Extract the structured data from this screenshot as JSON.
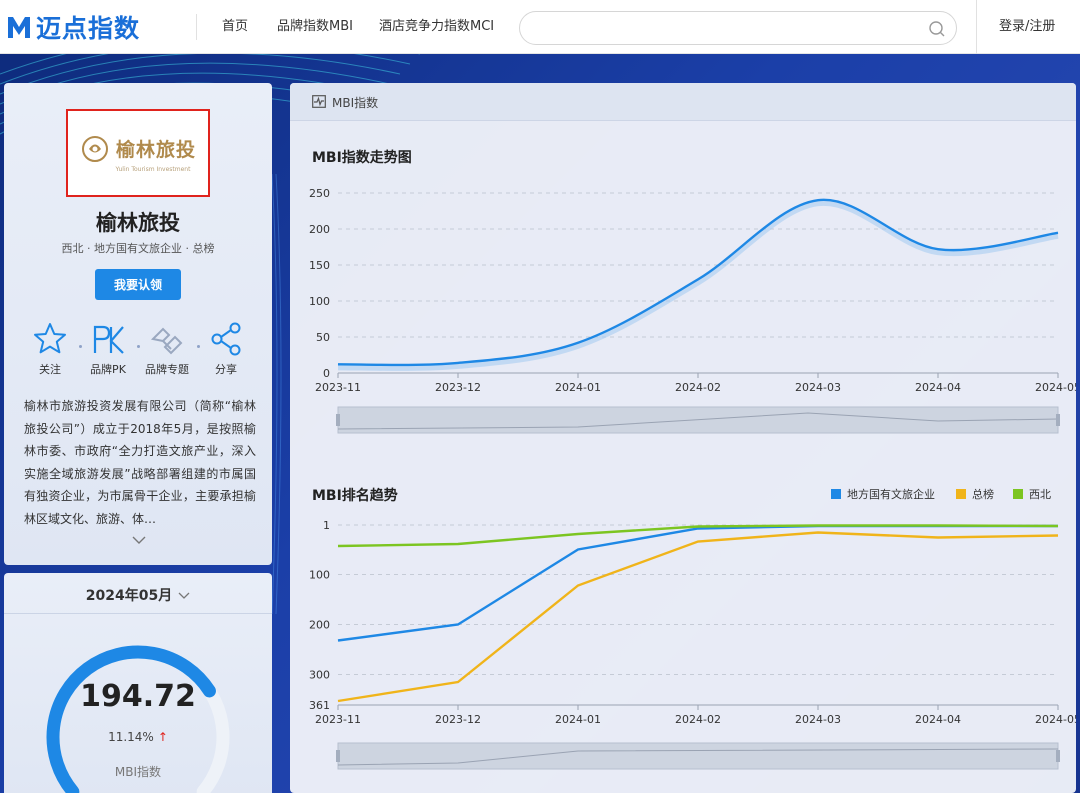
{
  "header": {
    "brand": "迈点指数",
    "nav": [
      "首页",
      "品牌指数MBI",
      "酒店竞争力指数MCI"
    ],
    "search_placeholder": "",
    "login": "登录/注册"
  },
  "profile": {
    "logo_text": "榆林旅投",
    "logo_sub": "Yulin Tourism Investment",
    "name": "榆林旅投",
    "meta": "西北 · 地方国有文旅企业 · 总榜",
    "claim_label": "我要认领",
    "actions": [
      {
        "label": "关注",
        "icon": "star-icon"
      },
      {
        "label": "品牌PK",
        "icon": "pk-icon"
      },
      {
        "label": "品牌专题",
        "icon": "handshake-icon"
      },
      {
        "label": "分享",
        "icon": "share-icon"
      }
    ],
    "description": "榆林市旅游投资发展有限公司（简称“榆林旅投公司”）成立于2018年5月，是按照榆林市委、市政府“全力打造文旅产业，深入实施全域旅游发展”战略部署组建的市属国有独资企业，为市属骨干企业，主要承担榆林区域文化、旅游、体…"
  },
  "period": {
    "label": "2024年05月",
    "value": "194.72",
    "change": "11.14%",
    "change_arrow": "↑",
    "index_label": "MBI指数",
    "gauge_fraction": 0.72
  },
  "panel": {
    "title": "MBI指数"
  },
  "chart_data": [
    {
      "type": "line",
      "title": "MBI指数走势图",
      "x": [
        "2023-11",
        "2023-12",
        "2024-01",
        "2024-02",
        "2024-03",
        "2024-04",
        "2024-05"
      ],
      "series": [
        {
          "values": [
            12,
            14,
            42,
            130,
            240,
            172,
            194.72
          ]
        }
      ],
      "ylim": [
        0,
        250
      ],
      "yticks": [
        0,
        50,
        100,
        150,
        200,
        250
      ],
      "grid": true,
      "color": "#1e88e5"
    },
    {
      "type": "line",
      "title": "MBI排名趋势",
      "x": [
        "2023-11",
        "2023-12",
        "2024-01",
        "2024-02",
        "2024-03",
        "2024-04",
        "2024-05"
      ],
      "y_inverted": true,
      "ylim": [
        1,
        361
      ],
      "yticks": [
        1,
        100,
        200,
        300,
        361
      ],
      "grid": true,
      "legend_position": "top-right",
      "series": [
        {
          "name": "地方国有文旅企业",
          "color": "#1e88e5",
          "values": [
            232,
            200,
            50,
            8,
            3,
            3,
            3
          ]
        },
        {
          "name": "总榜",
          "color": "#f0b41a",
          "values": [
            353,
            315,
            122,
            34,
            16,
            26,
            22
          ]
        },
        {
          "name": "西北",
          "color": "#7cc521",
          "values": [
            43,
            39,
            19,
            4,
            2,
            2,
            3
          ]
        }
      ]
    }
  ]
}
